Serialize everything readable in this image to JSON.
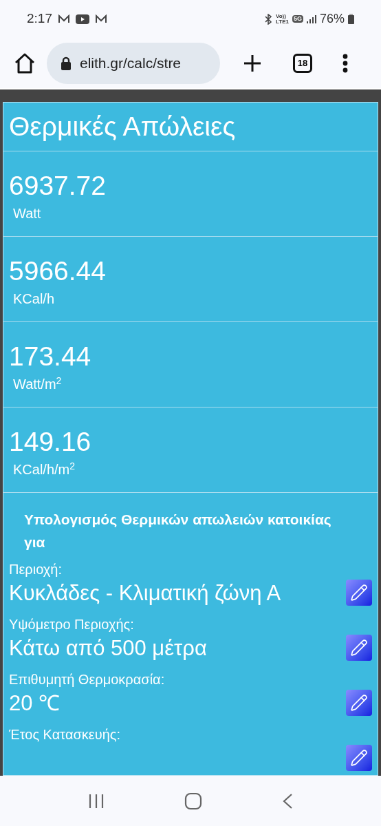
{
  "status_bar": {
    "time": "2:17",
    "volte": "Vo))",
    "lte": "LTE1",
    "network": "5G",
    "battery": "76%"
  },
  "browser": {
    "url": "elith.gr/calc/stre",
    "tab_count": "18"
  },
  "title": "Θερμικές Απώλειες",
  "results": [
    {
      "value": "6937.72",
      "unit": "Watt"
    },
    {
      "value": "5966.44",
      "unit": "KCal/h"
    },
    {
      "value": "173.44",
      "unit": "Watt/m$^{2}$"
    },
    {
      "value": "149.16",
      "unit": "KCal/h/m$^{2}$"
    }
  ],
  "summary_heading": "Υπολογισμός Θερμικών απωλειών κατοικίας για",
  "parameters": [
    {
      "label": "Περιοχή:",
      "value": "Κυκλάδες - Κλιματική ζώνη Α"
    },
    {
      "label": "Υψόμετρο Περιοχής:",
      "value": "Κάτω από 500 μέτρα"
    },
    {
      "label": "Επιθυμητή Θερμοκρασία:",
      "value": "20 ℃"
    },
    {
      "label": "Έτος Κατασκευής:"
    }
  ]
}
